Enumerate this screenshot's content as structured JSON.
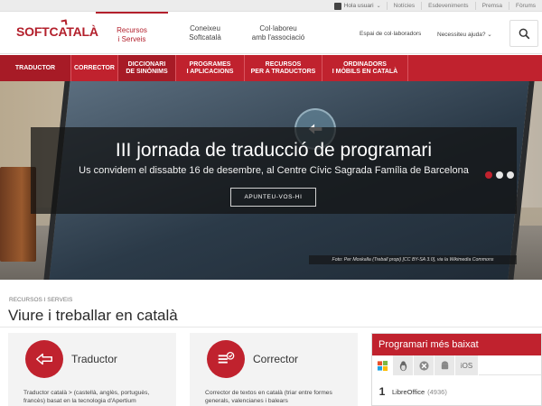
{
  "topbar": {
    "user_label": "Hola usuari",
    "links": [
      "Notícies",
      "Esdeveniments",
      "Premsa",
      "Fòrums"
    ]
  },
  "header": {
    "logo": "SOFTCATALÀ",
    "nav": [
      {
        "label": "Recursos\ni Serveis",
        "active": true
      },
      {
        "label": "Coneixeu\nSoftcatalà",
        "active": false
      },
      {
        "label": "Col·laboreu\namb l'associació",
        "active": false
      }
    ],
    "espai": "Espai de col·laboradors",
    "help": "Necessiteu ajuda?"
  },
  "rednav": [
    {
      "label": "TRADUCTOR",
      "style": "dark"
    },
    {
      "label": "CORRECTOR",
      "style": "normal"
    },
    {
      "label": "DICCIONARI\nDE SINÒNIMS",
      "style": "dark"
    },
    {
      "label": "PROGRAMES\nI APLICACIONS",
      "style": "normal"
    },
    {
      "label": "RECURSOS\nPER A TRADUCTORS",
      "style": "normal"
    },
    {
      "label": "ORDINADORS\nI MÒBILS EN CATALÀ",
      "style": "normal"
    }
  ],
  "hero": {
    "title": "III jornada de traducció de programari",
    "subtitle": "Us convidem el dissabte 16 de desembre, al Centre Cívic Sagrada Família de Barcelona",
    "button": "APUNTEU-VOS-HI",
    "credit": "Foto: Per Moskalla (Treball propi) [CC BY-SA 3.0], via la Wikimedia Commons",
    "slides": 3,
    "active_slide": 0
  },
  "content": {
    "breadcrumb": "RECURSOS I SERVEIS",
    "title": "Viure i treballar en català",
    "cards": [
      {
        "title": "Traductor",
        "desc": "Traductor català > (castellà, anglès, portuguès, francès) basat en la tecnologia d'Apertium"
      },
      {
        "title": "Corrector",
        "desc": "Corrector de textos en català (triar entre formes generals, valencianes i balears"
      }
    ]
  },
  "panel": {
    "title": "Programari més baixat",
    "tabs": [
      "windows-icon",
      "linux-icon",
      "mac-icon",
      "android-icon",
      "iOS"
    ],
    "rows": [
      {
        "rank": "1",
        "name": "LibreOffice",
        "count": "(4936)"
      }
    ]
  },
  "colors": {
    "brand_red": "#c0222e",
    "brand_red_dark": "#a71b26"
  }
}
